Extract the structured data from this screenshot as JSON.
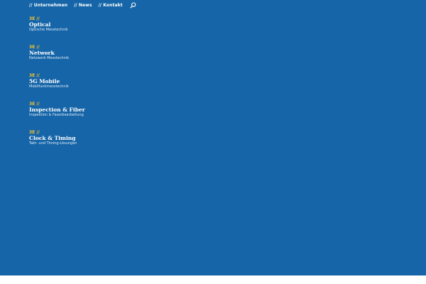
{
  "nav": {
    "links": [
      {
        "label": "// Unternehmen"
      },
      {
        "label": "// News"
      },
      {
        "label": "// Kontakt"
      }
    ],
    "search_icon": "search-icon"
  },
  "menu": {
    "items": [
      {
        "tag": "3E //",
        "title": "Optical",
        "subtitle": "Optische Messtechnik"
      },
      {
        "tag": "3E //",
        "title": "Network",
        "subtitle": "Netzwerk Messtechnik"
      },
      {
        "tag": "3E //",
        "title": "5G Mobile",
        "subtitle": "Mobilfunkmesstechnik"
      },
      {
        "tag": "3E //",
        "title": "Inspection & Fiber",
        "subtitle": "Inspektion & Faserbearbeitung"
      },
      {
        "tag": "3E //",
        "title": "Clock & Timing",
        "subtitle": "Takt- und Timing-Lösungen"
      }
    ]
  },
  "colors": {
    "background": "#1565a8",
    "accent": "#f3c332",
    "text": "#ffffff"
  }
}
